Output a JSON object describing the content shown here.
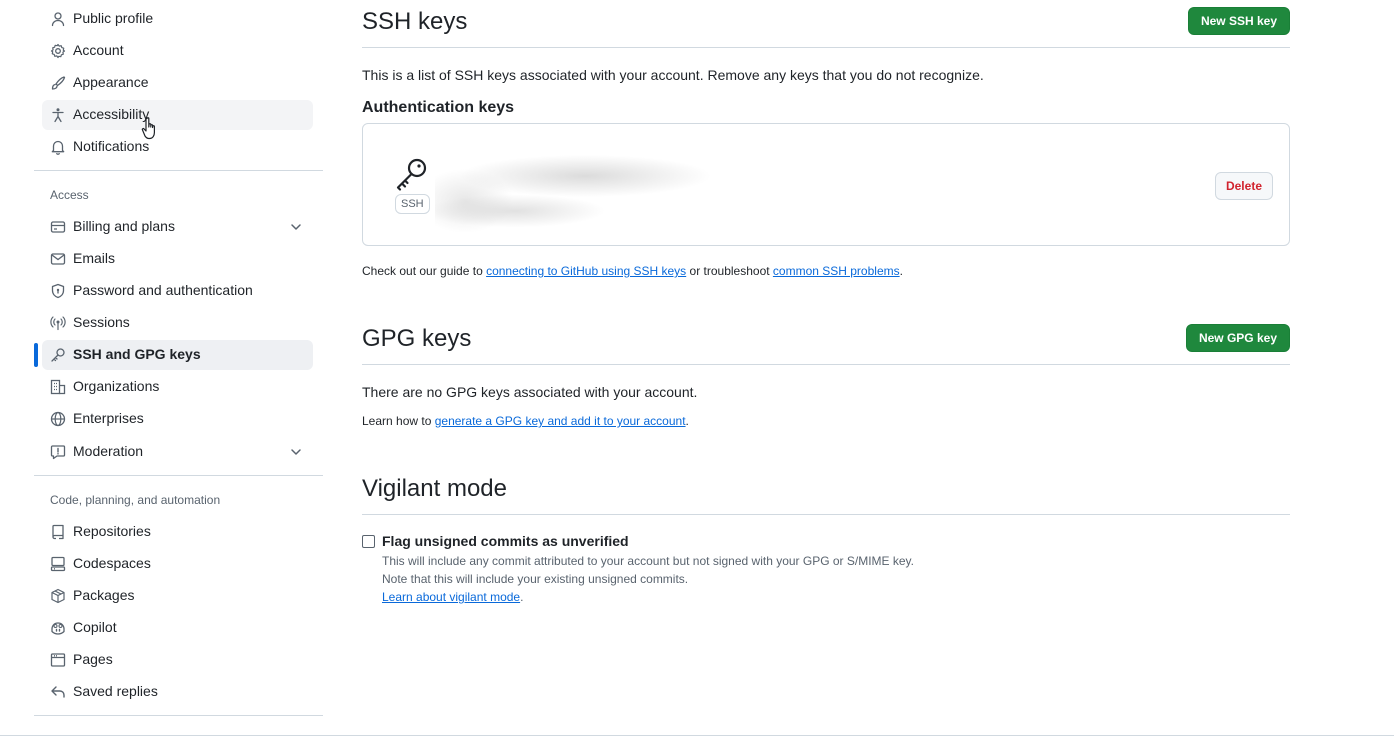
{
  "sidebar": {
    "items_top": [
      {
        "label": "Public profile",
        "icon": "person-icon"
      },
      {
        "label": "Account",
        "icon": "gear-icon"
      },
      {
        "label": "Appearance",
        "icon": "paintbrush-icon"
      },
      {
        "label": "Accessibility",
        "icon": "accessibility-icon"
      },
      {
        "label": "Notifications",
        "icon": "bell-icon"
      }
    ],
    "access_heading": "Access",
    "access_items": [
      {
        "label": "Billing and plans",
        "icon": "credit-card-icon"
      },
      {
        "label": "Emails",
        "icon": "mail-icon"
      },
      {
        "label": "Password and authentication",
        "icon": "shield-lock-icon"
      },
      {
        "label": "Sessions",
        "icon": "broadcast-icon"
      },
      {
        "label": "SSH and GPG keys",
        "icon": "key-icon"
      },
      {
        "label": "Organizations",
        "icon": "organization-icon"
      },
      {
        "label": "Enterprises",
        "icon": "globe-icon"
      },
      {
        "label": "Moderation",
        "icon": "report-icon"
      }
    ],
    "code_heading": "Code, planning, and automation",
    "code_items": [
      {
        "label": "Repositories",
        "icon": "repo-icon"
      },
      {
        "label": "Codespaces",
        "icon": "codespaces-icon"
      },
      {
        "label": "Packages",
        "icon": "package-icon"
      },
      {
        "label": "Copilot",
        "icon": "copilot-icon"
      },
      {
        "label": "Pages",
        "icon": "browser-icon"
      },
      {
        "label": "Saved replies",
        "icon": "reply-icon"
      }
    ]
  },
  "ssh": {
    "title": "SSH keys",
    "new_button": "New SSH key",
    "description": "This is a list of SSH keys associated with your account. Remove any keys that you do not recognize.",
    "auth_heading": "Authentication keys",
    "key_badge": "SSH",
    "delete_button": "Delete",
    "guide_prefix": "Check out our guide to ",
    "guide_link": "connecting to GitHub using SSH keys",
    "guide_middle": " or troubleshoot ",
    "troubleshoot_link": "common SSH problems",
    "guide_suffix": "."
  },
  "gpg": {
    "title": "GPG keys",
    "new_button": "New GPG key",
    "empty_text": "There are no GPG keys associated with your account.",
    "learn_prefix": "Learn how to ",
    "learn_link": "generate a GPG key and add it to your account",
    "learn_suffix": "."
  },
  "vigilant": {
    "title": "Vigilant mode",
    "checkbox_label": "Flag unsigned commits as unverified",
    "checked": false,
    "note_line1": "This will include any commit attributed to your account but not signed with your GPG or S/MIME key.",
    "note_line2": "Note that this will include your existing unsigned commits.",
    "learn_link": "Learn about vigilant mode",
    "learn_suffix": "."
  },
  "colors": {
    "accent": "#0969da",
    "primary_button": "#1f883d",
    "danger": "#d1242f",
    "border": "#d1d9e0"
  }
}
